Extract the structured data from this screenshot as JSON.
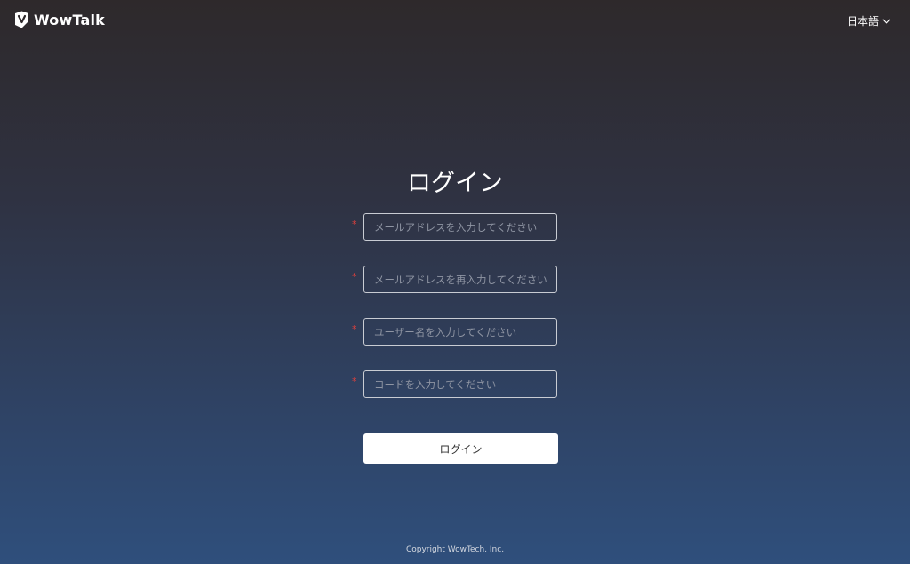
{
  "header": {
    "app_name": "WowTalk",
    "logo_icon": "wowtalk-logo-icon",
    "language": "日本語",
    "language_icon": "chevron-down-icon"
  },
  "login": {
    "title": "ログイン",
    "required_mark": "*",
    "fields": [
      {
        "placeholder": "メールアドレスを入力してください",
        "value": ""
      },
      {
        "placeholder": "メールアドレスを再入力してください",
        "value": ""
      },
      {
        "placeholder": "ユーザー名を入力してください",
        "value": ""
      },
      {
        "placeholder": "コードを入力してください",
        "value": ""
      }
    ],
    "submit_label": "ログイン"
  },
  "footer": {
    "copyright": "Copyright WowTech, Inc."
  },
  "colors": {
    "background_top": "#2e292b",
    "background_bottom": "#2f4f7c",
    "required": "#e0403c",
    "button_bg": "#ffffff"
  }
}
